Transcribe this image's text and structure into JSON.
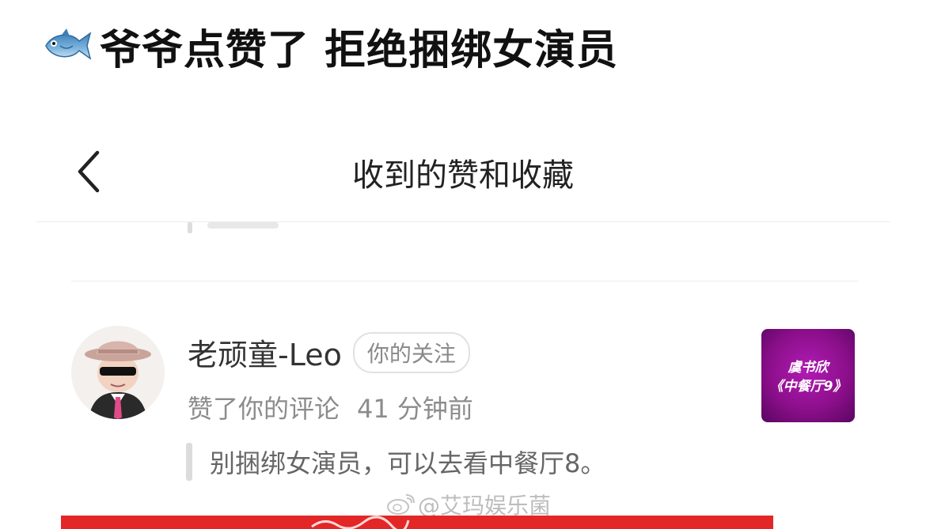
{
  "headline": {
    "emoji": "fish-icon",
    "text": "爷爷点赞了 拒绝捆绑女演员"
  },
  "navbar": {
    "back_icon": "chevron-left-icon",
    "title": "收到的赞和收藏"
  },
  "notification": {
    "username": "老顽童-Leo",
    "follow_badge": "你的关注",
    "action": "赞了你的评论",
    "time": "41 分钟前",
    "comment": "别捆绑女演员，可以去看中餐厅8。",
    "thumbnail": {
      "line1": "虞书欣",
      "line2": "《中餐厅9》",
      "color": "#9b169b"
    }
  },
  "watermark": {
    "icon": "weibo-icon",
    "text": "@艾玛娱乐菌"
  },
  "colors": {
    "accent_red": "#e32626"
  }
}
